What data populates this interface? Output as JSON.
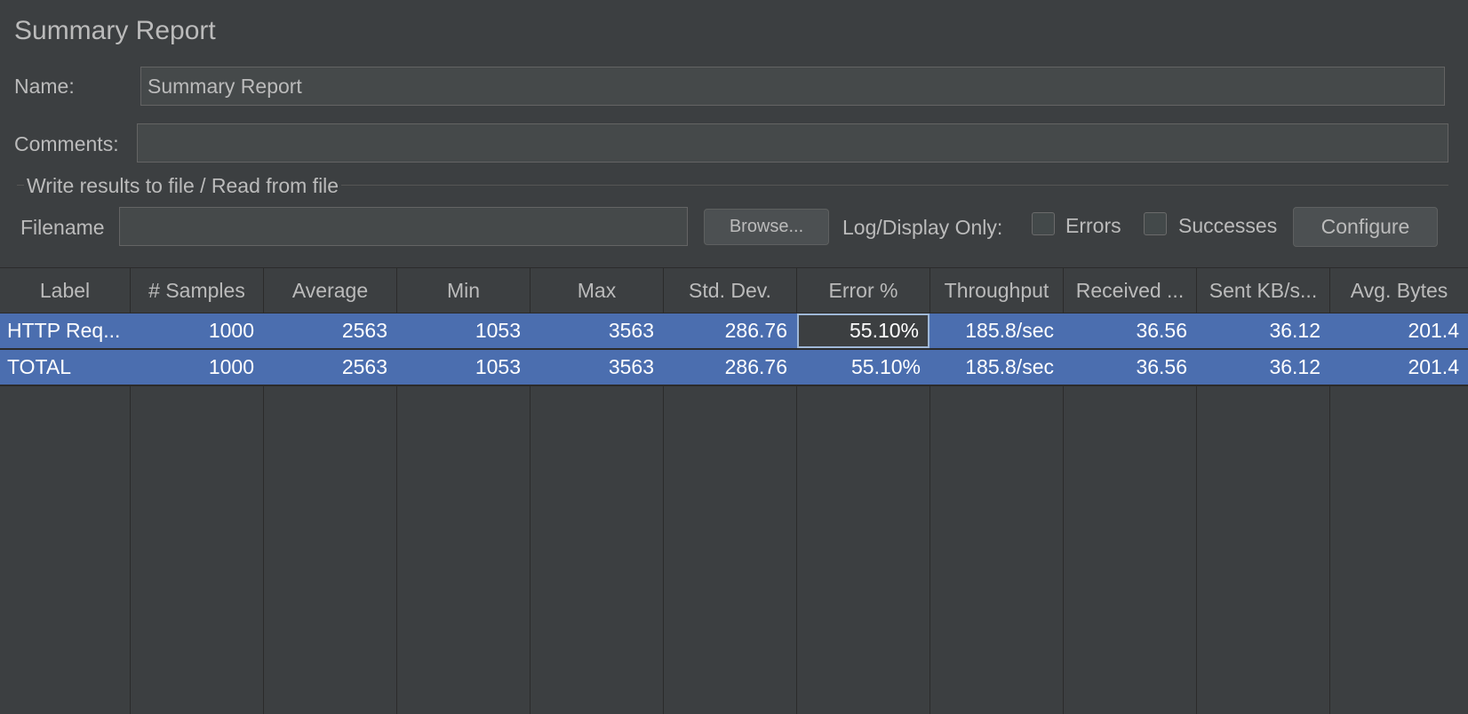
{
  "panel": {
    "title": "Summary Report"
  },
  "name_field": {
    "label": "Name:",
    "value": "Summary Report"
  },
  "comments_field": {
    "label": "Comments:",
    "value": ""
  },
  "file_group": {
    "title": "Write results to file / Read from file",
    "filename_label": "Filename",
    "filename_value": "",
    "browse_label": "Browse...",
    "log_display_label": "Log/Display Only:",
    "errors_label": "Errors",
    "errors_checked": false,
    "successes_label": "Successes",
    "successes_checked": false,
    "configure_label": "Configure"
  },
  "table": {
    "columns": [
      "Label",
      "# Samples",
      "Average",
      "Min",
      "Max",
      "Std. Dev.",
      "Error %",
      "Throughput",
      "Received ...",
      "Sent KB/s...",
      "Avg. Bytes"
    ],
    "rows": [
      [
        "HTTP Req...",
        "1000",
        "2563",
        "1053",
        "3563",
        "286.76",
        "55.10%",
        "185.8/sec",
        "36.56",
        "36.12",
        "201.4"
      ],
      [
        "TOTAL",
        "1000",
        "2563",
        "1053",
        "3563",
        "286.76",
        "55.10%",
        "185.8/sec",
        "36.56",
        "36.12",
        "201.4"
      ]
    ],
    "selection_color": "#4b6eaf"
  }
}
